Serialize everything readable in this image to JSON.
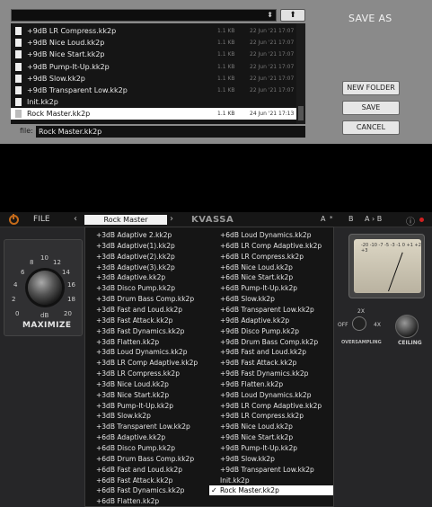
{
  "save_dialog": {
    "title": "SAVE AS",
    "files": [
      {
        "name": "+9dB LR Compress.kk2p",
        "size": "1.1 KB",
        "date": "22 Jun '21 17:07"
      },
      {
        "name": "+9dB Nice Loud.kk2p",
        "size": "1.1 KB",
        "date": "22 Jun '21 17:07"
      },
      {
        "name": "+9dB Nice Start.kk2p",
        "size": "1.1 KB",
        "date": "22 Jun '21 17:07"
      },
      {
        "name": "+9dB Pump-It-Up.kk2p",
        "size": "1.1 KB",
        "date": "22 Jun '21 17:07"
      },
      {
        "name": "+9dB Slow.kk2p",
        "size": "1.1 KB",
        "date": "22 Jun '21 17:07"
      },
      {
        "name": "+9dB Transparent Low.kk2p",
        "size": "1.1 KB",
        "date": "22 Jun '21 17:07"
      },
      {
        "name": "Init.kk2p",
        "size": "",
        "date": ""
      },
      {
        "name": "Rock Master.kk2p",
        "size": "1.1 KB",
        "date": "24 Jun '21 17:13"
      }
    ],
    "selected_index": 7,
    "file_label": "file:",
    "file_value": "Rock Master.kk2p",
    "new_folder": "NEW FOLDER",
    "save": "SAVE",
    "cancel": "CANCEL",
    "up_arrow": "⬆",
    "dropdown_arrow": "⬍"
  },
  "plugin": {
    "file_menu": "FILE",
    "preset_name": "Rock Master",
    "nav_prev": "‹",
    "nav_next": "›",
    "logo": "KVASSA",
    "ab_a": "A",
    "ab_toggle": "*",
    "ab_b": "B",
    "ab_copy": "A › B",
    "info": "ⓘ",
    "maximize": {
      "label": "MAXIMIZE",
      "unit": "dB",
      "ticks": [
        "0",
        "2",
        "4",
        "6",
        "8",
        "10",
        "12",
        "14",
        "16",
        "18",
        "20"
      ]
    },
    "oversampling": {
      "label": "OVERSAMPLING",
      "off": "OFF",
      "x2": "2X",
      "x4": "4X"
    },
    "ceiling": {
      "label": "CEILING"
    },
    "vu_scale": "-20 -10 -7 -5 -3 -1 0 +1 +2 +3"
  },
  "menu": {
    "col1": [
      "+3dB Adaptive 2.kk2p",
      "+3dB Adaptive(1).kk2p",
      "+3dB Adaptive(2).kk2p",
      "+3dB Adaptive(3).kk2p",
      "+3dB Adaptive.kk2p",
      "+3dB Disco Pump.kk2p",
      "+3dB Drum Bass Comp.kk2p",
      "+3dB Fast and Loud.kk2p",
      "+3dB Fast Attack.kk2p",
      "+3dB Fast Dynamics.kk2p",
      "+3dB Flatten.kk2p",
      "+3dB Loud Dynamics.kk2p",
      "+3dB LR Comp Adaptive.kk2p",
      "+3dB LR Compress.kk2p",
      "+3dB Nice Loud.kk2p",
      "+3dB Nice Start.kk2p",
      "+3dB Pump-It-Up.kk2p",
      "+3dB Slow.kk2p",
      "+3dB Transparent Low.kk2p",
      "+6dB Adaptive.kk2p",
      "+6dB Disco Pump.kk2p",
      "+6dB Drum Bass Comp.kk2p",
      "+6dB Fast and Loud.kk2p",
      "+6dB Fast Attack.kk2p",
      "+6dB Fast Dynamics.kk2p",
      "+6dB Flatten.kk2p"
    ],
    "col2": [
      "+6dB Loud Dynamics.kk2p",
      "+6dB LR Comp Adaptive.kk2p",
      "+6dB LR Compress.kk2p",
      "+6dB Nice Loud.kk2p",
      "+6dB Nice Start.kk2p",
      "+6dB Pump-It-Up.kk2p",
      "+6dB Slow.kk2p",
      "+6dB Transparent Low.kk2p",
      "+9dB Adaptive.kk2p",
      "+9dB Disco Pump.kk2p",
      "+9dB Drum Bass Comp.kk2p",
      "+9dB Fast and Loud.kk2p",
      "+9dB Fast Attack.kk2p",
      "+9dB Fast Dynamics.kk2p",
      "+9dB Flatten.kk2p",
      "+9dB Loud Dynamics.kk2p",
      "+9dB LR Comp Adaptive.kk2p",
      "+9dB LR Compress.kk2p",
      "+9dB Nice Loud.kk2p",
      "+9dB Nice Start.kk2p",
      "+9dB Pump-It-Up.kk2p",
      "+9dB Slow.kk2p",
      "+9dB Transparent Low.kk2p",
      "Init.kk2p",
      "Rock Master.kk2p"
    ],
    "selected": "Rock Master.kk2p",
    "check_mark": "✓"
  },
  "colors": {
    "accent_power": "#c46a1a",
    "bypass_red": "#d02020",
    "dialog_gray": "#8a8a8a"
  }
}
